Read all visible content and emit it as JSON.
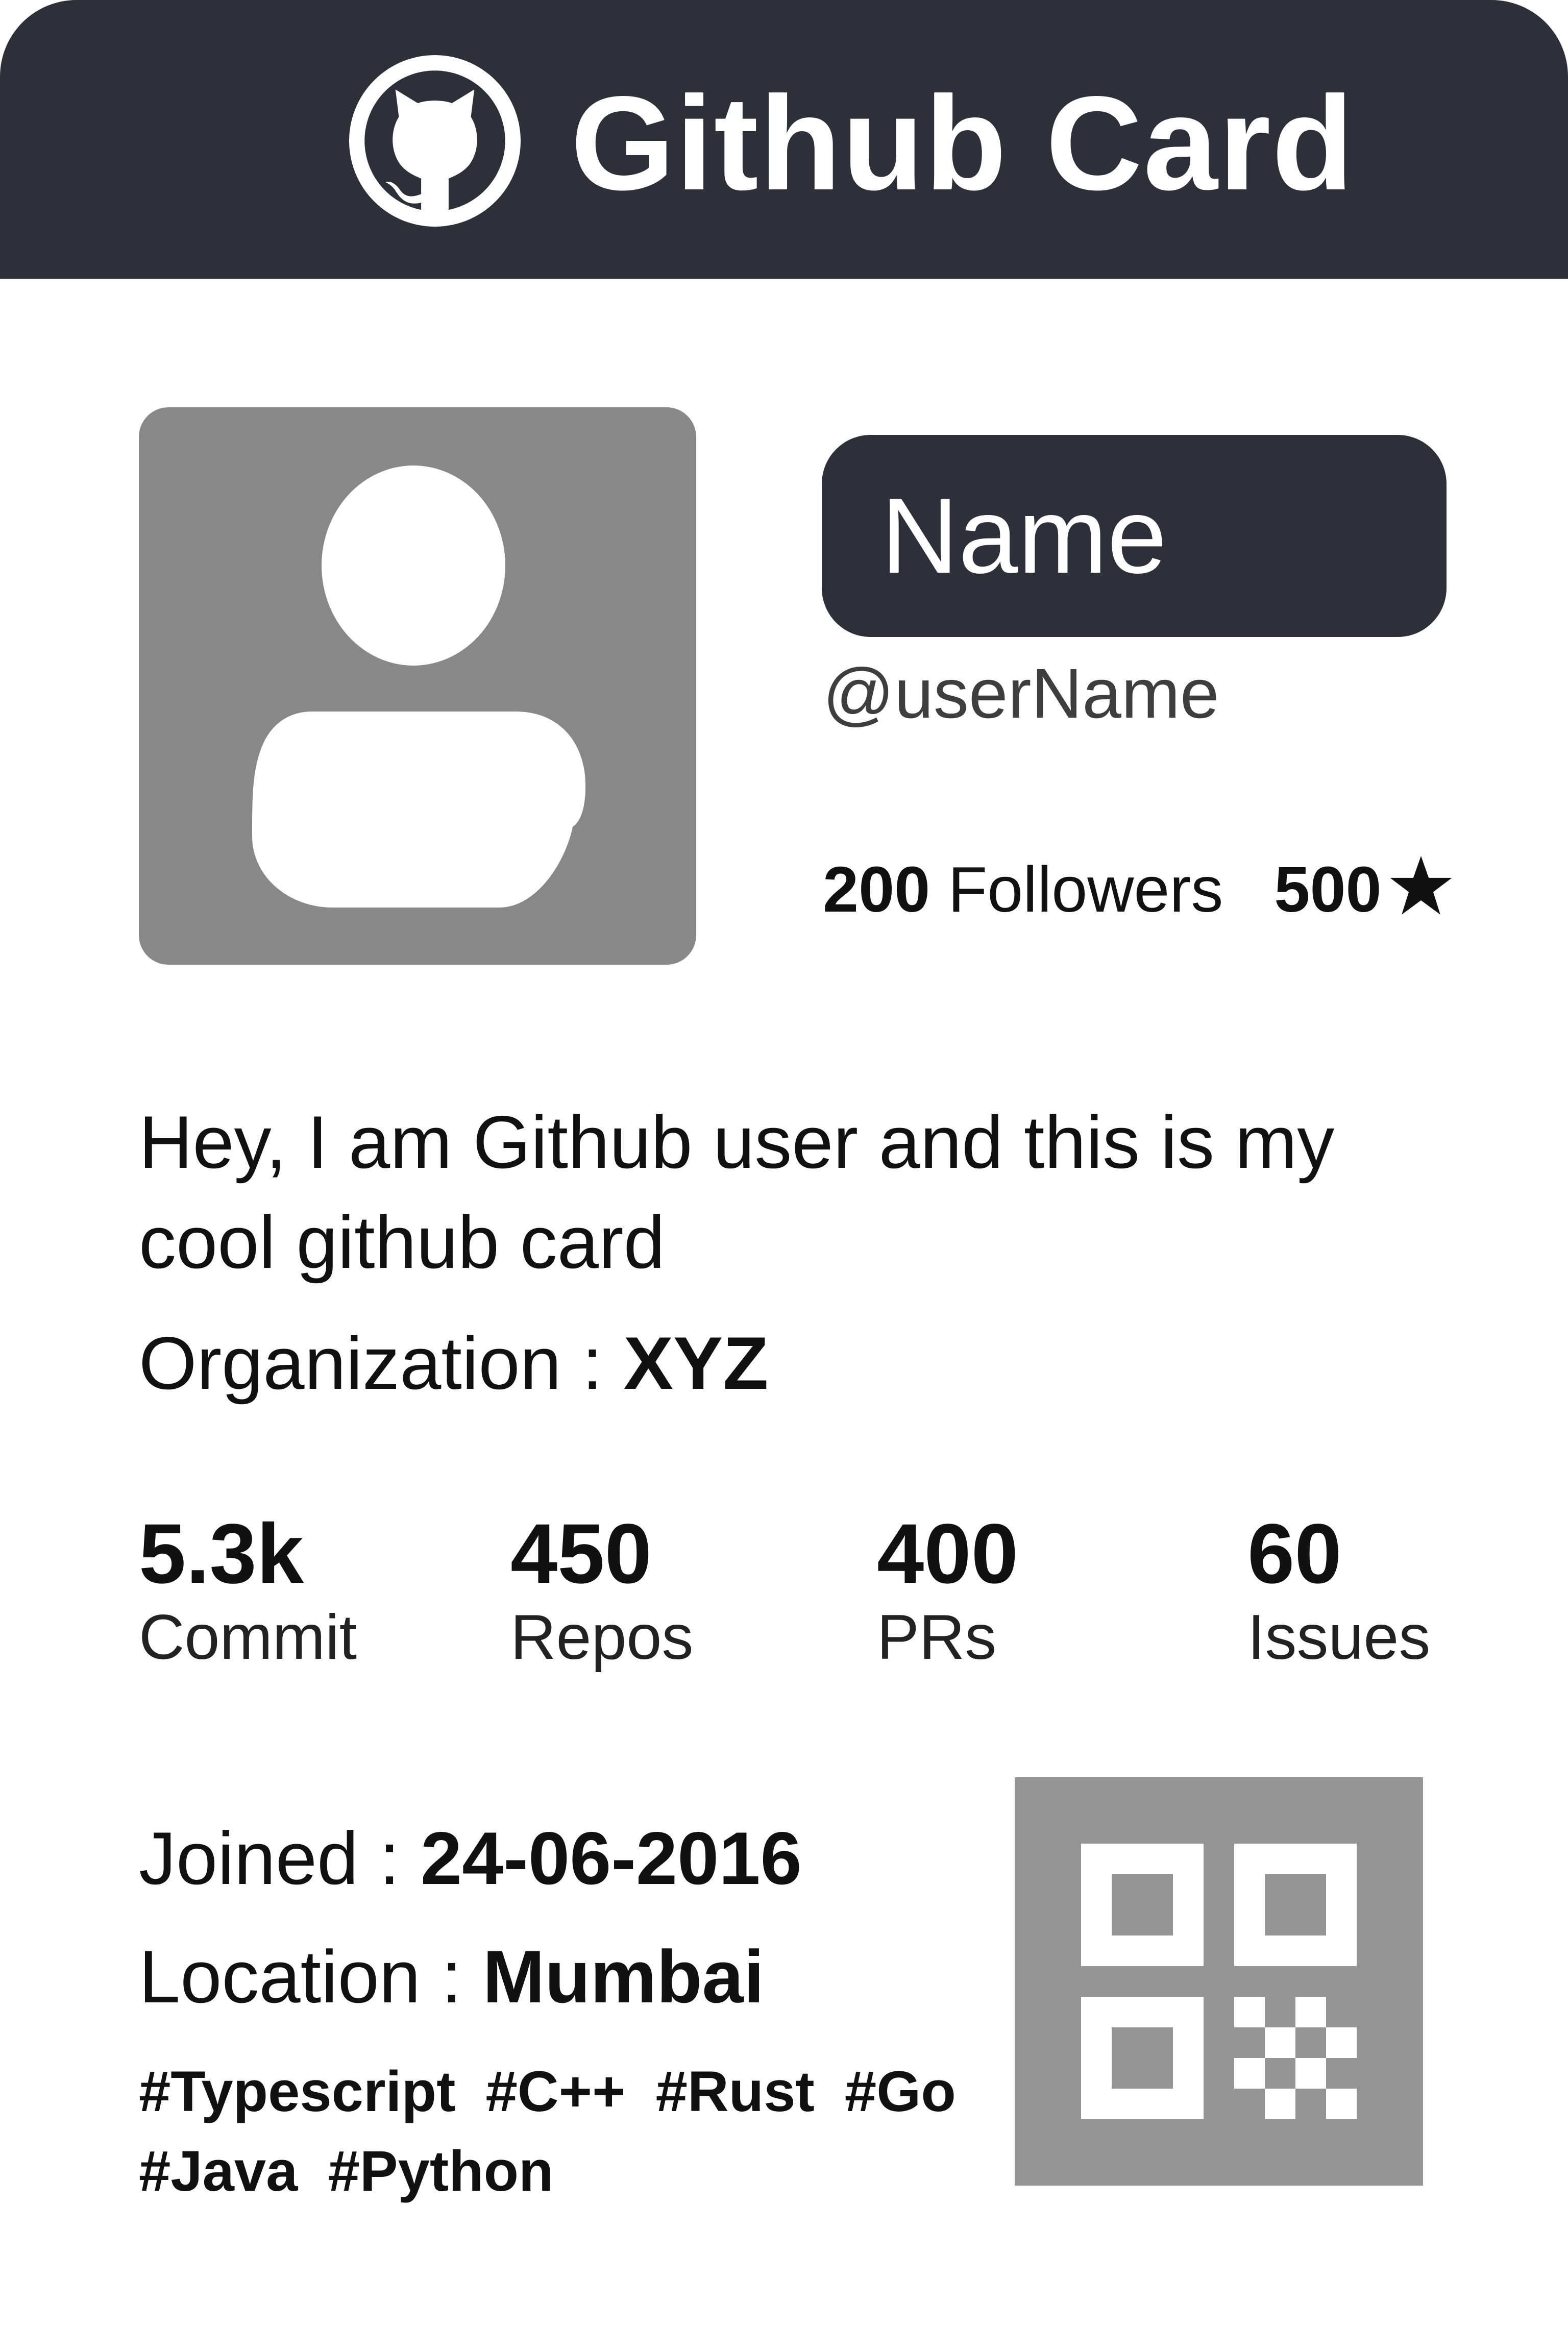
{
  "header": {
    "title": "Github Card",
    "logo_icon": "github-octocat-icon",
    "background": "#2d3038"
  },
  "profile": {
    "avatar_icon": "user-avatar-placeholder-icon",
    "name": "Name",
    "username": "@userName",
    "followers_count": "200",
    "followers_label": "Followers",
    "stars_count": "500",
    "star_icon": "star-icon"
  },
  "about": {
    "bio": "Hey, I am Github user and this is my cool github card",
    "organization_label": "Organization :",
    "organization_value": "XYZ"
  },
  "stats": [
    {
      "value": "5.3k",
      "label": "Commit"
    },
    {
      "value": "450",
      "label": "Repos"
    },
    {
      "value": "400",
      "label": "PRs"
    },
    {
      "value": "60",
      "label": "Issues"
    }
  ],
  "details": {
    "joined_label": "Joined :",
    "joined_value": "24-06-2016",
    "location_label": "Location :",
    "location_value": "Mumbai"
  },
  "tags": [
    "#Typescript",
    "#C++",
    "#Rust",
    "#Go",
    "#Java",
    "#Python"
  ],
  "qr_icon": "qr-code-icon",
  "colors": {
    "dark": "#2d3038",
    "avatar_bg": "#888888",
    "qr_bg": "#959595"
  }
}
